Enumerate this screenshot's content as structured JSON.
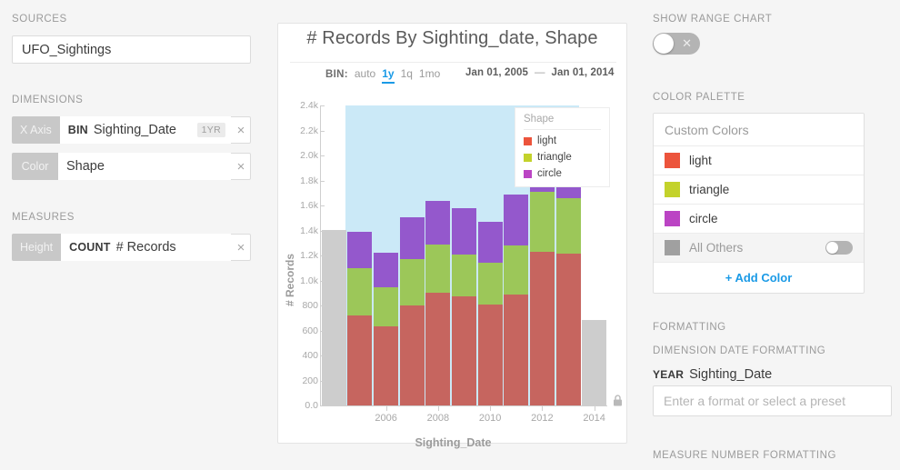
{
  "left_panel": {
    "sources_label": "SOURCES",
    "source_value": "UFO_Sightings",
    "dimensions_label": "DIMENSIONS",
    "measures_label": "MEASURES",
    "chips": [
      {
        "tag": "X Axis",
        "agg": "BIN",
        "name": "Sighting_Date",
        "badge": "1YR",
        "close": "×"
      },
      {
        "tag": "Color",
        "agg": "",
        "name": "Shape",
        "badge": "",
        "close": "×"
      },
      {
        "tag": "Height",
        "agg": "COUNT",
        "name": "# Records",
        "badge": "",
        "close": "×"
      }
    ]
  },
  "chart_card": {
    "title": "# Records By Sighting_date, Shape",
    "bin_label": "BIN:",
    "bin_options": [
      "auto",
      "1y",
      "1q",
      "1mo"
    ],
    "bin_selected": "1y",
    "range_start": "Jan 01, 2005",
    "range_dash": "—",
    "range_end": "Jan 01, 2014",
    "legend_title": "Shape",
    "lock_icon": "lock-icon"
  },
  "chart_data": {
    "type": "bar",
    "stacked": true,
    "title": "# Records By Sighting_date, Shape",
    "xlabel": "Sighting_Date",
    "ylabel": "# Records",
    "ylim": [
      0,
      2400
    ],
    "ytick_labels": [
      "0.0",
      "200",
      "400",
      "600",
      "800",
      "1.0k",
      "1.2k",
      "1.4k",
      "1.6k",
      "1.8k",
      "2.0k",
      "2.2k",
      "2.4k"
    ],
    "ytick_values": [
      0,
      200,
      400,
      600,
      800,
      1000,
      1200,
      1400,
      1600,
      1800,
      2000,
      2200,
      2400
    ],
    "xtick_labels": [
      "2006",
      "2008",
      "2010",
      "2012",
      "2014"
    ],
    "categories": [
      "2004",
      "2005",
      "2006",
      "2007",
      "2008",
      "2009",
      "2010",
      "2011",
      "2012",
      "2013",
      "2014"
    ],
    "legend_position": "inside-top-right",
    "grid": false,
    "series": [
      {
        "name": "light",
        "color": "#c6655f",
        "values": [
          null,
          722,
          632,
          803,
          900,
          872,
          810,
          886,
          1232,
          1213,
          null
        ]
      },
      {
        "name": "triangle",
        "color": "#9cc759",
        "values": [
          null,
          373,
          312,
          365,
          391,
          339,
          330,
          397,
          479,
          442,
          null
        ]
      },
      {
        "name": "circle",
        "color": "#9458cc",
        "values": [
          null,
          292,
          280,
          340,
          349,
          364,
          326,
          404,
          106,
          116,
          null
        ]
      },
      {
        "name": "All Others",
        "color": "#cdcdcd",
        "values": [
          1407,
          null,
          null,
          null,
          null,
          null,
          null,
          null,
          null,
          null,
          684
        ]
      }
    ],
    "bar_totals": [
      1407,
      1387,
      1224,
      1508,
      1640,
      1575,
      1466,
      1687,
      1817,
      1771,
      684
    ],
    "selected_range": [
      "Jan 01, 2005",
      "Jan 01, 2014"
    ]
  },
  "right_panel": {
    "show_range_chart_label": "SHOW RANGE CHART",
    "range_toggle_state": "off",
    "range_toggle_glyph": "✕",
    "color_palette_label": "COLOR PALETTE",
    "palette_title": "Custom Colors",
    "palette_rows": [
      {
        "name": "light",
        "color": "#ec543c",
        "has_toggle": false
      },
      {
        "name": "triangle",
        "color": "#c3d22b",
        "has_toggle": false
      },
      {
        "name": "circle",
        "color": "#bb44c4",
        "has_toggle": false
      },
      {
        "name": "All Others",
        "color": "#a0a0a0",
        "has_toggle": true
      }
    ],
    "add_color_label": "+ Add Color",
    "formatting_label": "FORMATTING",
    "dimension_date_formatting_label": "DIMENSION DATE FORMATTING",
    "year_tag": "YEAR",
    "year_field_name": "Sighting_Date",
    "format_input_value": "",
    "format_input_placeholder": "Enter a format or select a preset",
    "measure_number_formatting_label": "MEASURE NUMBER FORMATTING"
  }
}
